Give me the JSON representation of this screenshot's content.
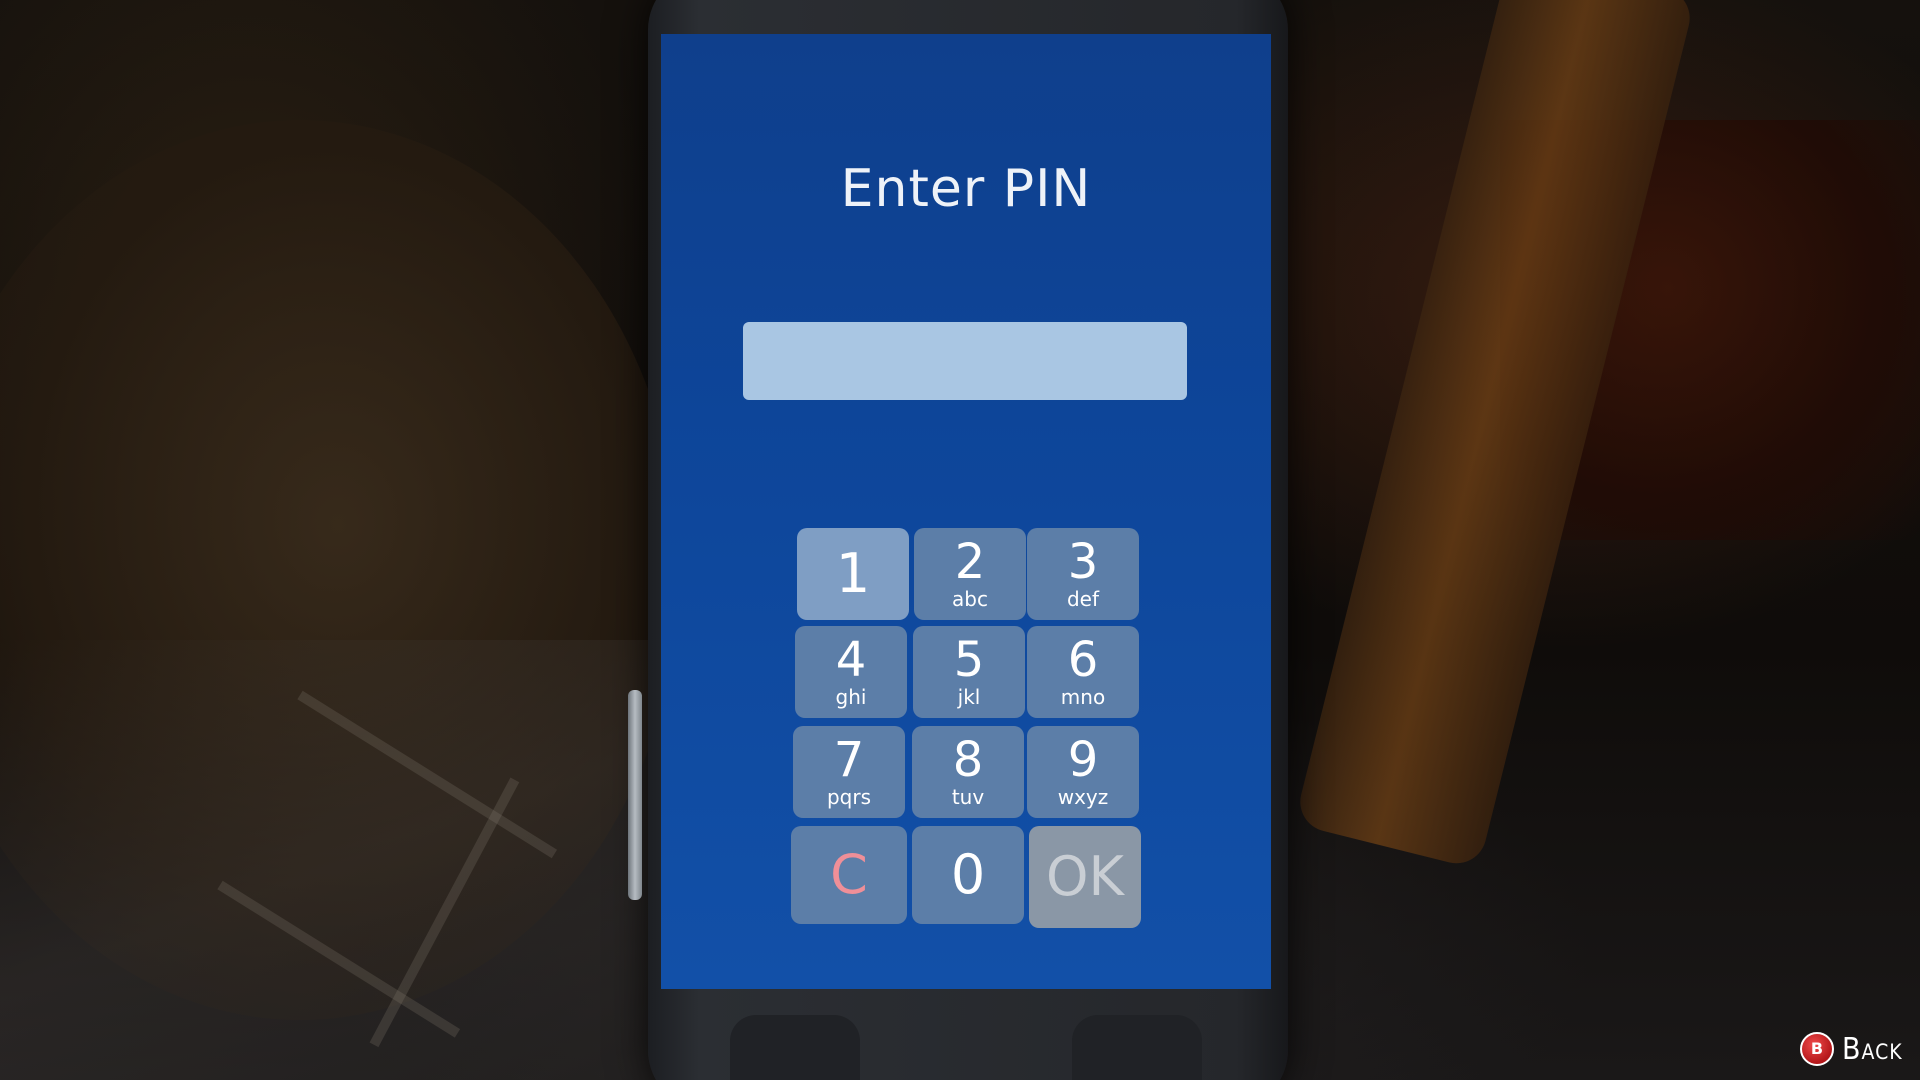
{
  "screen": {
    "title": "Enter PIN",
    "pin_value": ""
  },
  "keypad": {
    "keys": [
      {
        "digit": "1",
        "letters": ""
      },
      {
        "digit": "2",
        "letters": "abc"
      },
      {
        "digit": "3",
        "letters": "def"
      },
      {
        "digit": "4",
        "letters": "ghi"
      },
      {
        "digit": "5",
        "letters": "jkl"
      },
      {
        "digit": "6",
        "letters": "mno"
      },
      {
        "digit": "7",
        "letters": "pqrs"
      },
      {
        "digit": "8",
        "letters": "tuv"
      },
      {
        "digit": "9",
        "letters": "wxyz"
      },
      {
        "digit": "C",
        "letters": ""
      },
      {
        "digit": "0",
        "letters": ""
      },
      {
        "digit": "OK",
        "letters": ""
      }
    ]
  },
  "hud": {
    "back_button_glyph": "B",
    "back_label": "Back"
  },
  "colors": {
    "screen_blue": "#0d4599",
    "key_blue": "#5c7ea8",
    "clear_red": "#ef8f98",
    "back_button_red": "#c61c1f"
  }
}
